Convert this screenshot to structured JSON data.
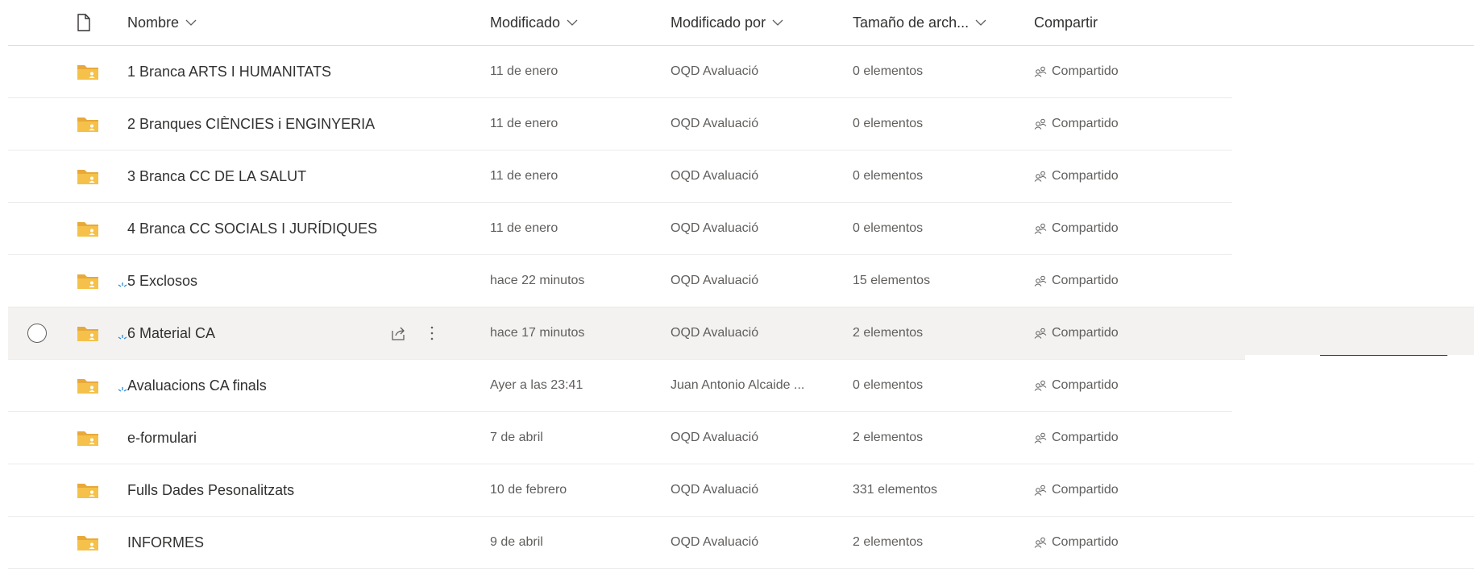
{
  "header": {
    "file_type_icon": "document-icon",
    "columns": {
      "name": "Nombre",
      "modified": "Modificado",
      "modified_by": "Modificado por",
      "size": "Tamaño de arch...",
      "share": "Compartir"
    }
  },
  "colors": {
    "folder": "#f5c14a",
    "folder_dark": "#e8a93a",
    "new_mark": "#2b88d8",
    "hover_row": "#f3f2f1"
  },
  "rows": [
    {
      "name": "1 Branca ARTS I HUMANITATS",
      "modified": "11 de enero",
      "modified_by": "OQD Avaluació",
      "size": "0 elementos",
      "share": "Compartido",
      "is_new": false
    },
    {
      "name": "2 Branques CIÈNCIES i ENGINYERIA",
      "modified": "11 de enero",
      "modified_by": "OQD Avaluació",
      "size": "0 elementos",
      "share": "Compartido",
      "is_new": false
    },
    {
      "name": "3 Branca CC DE LA SALUT",
      "modified": "11 de enero",
      "modified_by": "OQD Avaluació",
      "size": "0 elementos",
      "share": "Compartido",
      "is_new": false
    },
    {
      "name": "4 Branca CC SOCIALS I JURÍDIQUES",
      "modified": "11 de enero",
      "modified_by": "OQD Avaluació",
      "size": "0 elementos",
      "share": "Compartido",
      "is_new": false
    },
    {
      "name": "5 Exclosos",
      "modified": "hace 22 minutos",
      "modified_by": "OQD Avaluació",
      "size": "15 elementos",
      "share": "Compartido",
      "is_new": true
    },
    {
      "name": "6 Material CA",
      "modified": "hace 17 minutos",
      "modified_by": "OQD Avaluació",
      "size": "2 elementos",
      "share": "Compartido",
      "is_new": true
    },
    {
      "name": "Avaluacions CA finals",
      "modified": "Ayer a las 23:41",
      "modified_by": "Juan Antonio Alcaide ...",
      "size": "0 elementos",
      "share": "Compartido",
      "is_new": true
    },
    {
      "name": "e-formulari",
      "modified": "7 de abril",
      "modified_by": "OQD Avaluació",
      "size": "2 elementos",
      "share": "Compartido",
      "is_new": false
    },
    {
      "name": "Fulls Dades Pesonalitzats",
      "modified": "10 de febrero",
      "modified_by": "OQD Avaluació",
      "size": "331 elementos",
      "share": "Compartido",
      "is_new": false
    },
    {
      "name": "INFORMES",
      "modified": "9 de abril",
      "modified_by": "OQD Avaluació",
      "size": "2 elementos",
      "share": "Compartido",
      "is_new": false
    }
  ]
}
